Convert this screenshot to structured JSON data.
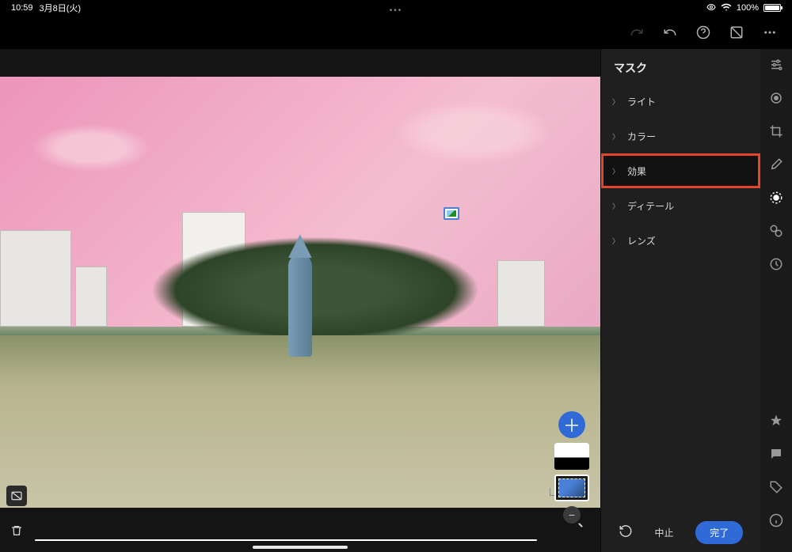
{
  "status": {
    "time": "10:59",
    "date": "3月8日(火)",
    "battery": "100%"
  },
  "panel": {
    "title": "マスク",
    "items": [
      {
        "label": "ライト"
      },
      {
        "label": "カラー"
      },
      {
        "label": "効果",
        "highlighted": true
      },
      {
        "label": "ディテール"
      },
      {
        "label": "レンズ"
      }
    ],
    "footer": {
      "cancel": "中止",
      "done": "完了"
    }
  }
}
